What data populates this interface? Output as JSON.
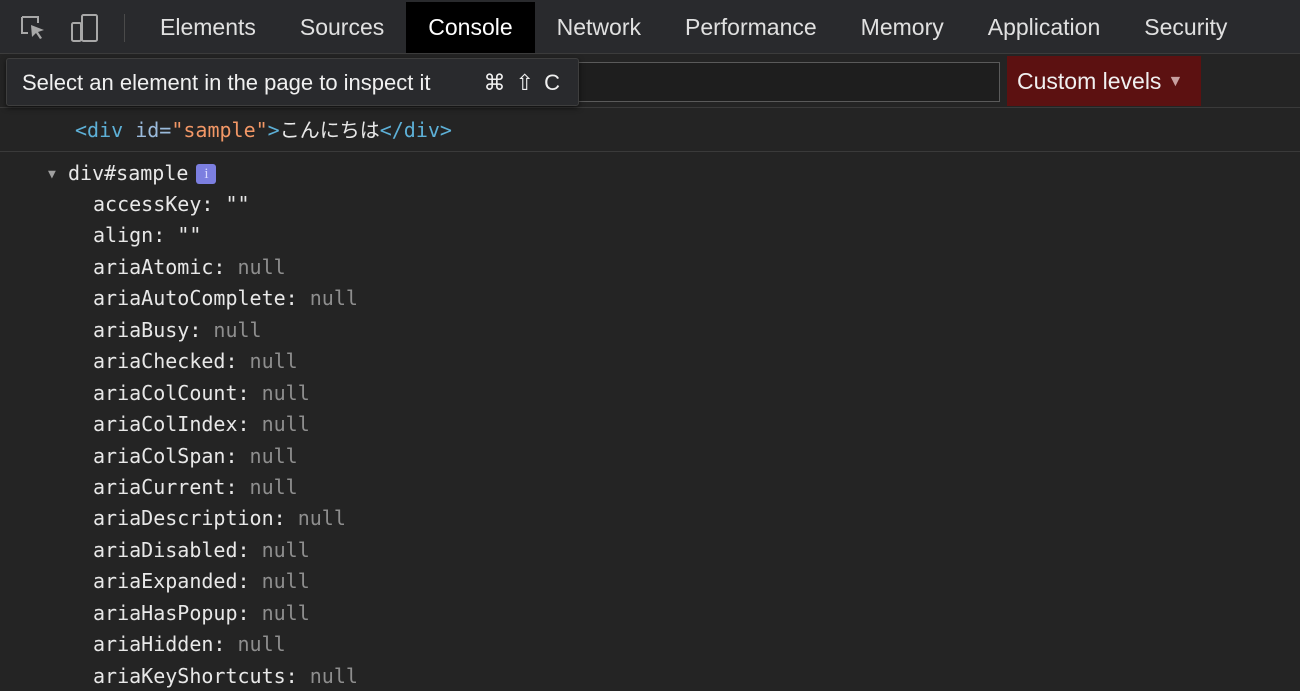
{
  "tabbar": {
    "tabs": [
      {
        "label": "Elements",
        "active": false
      },
      {
        "label": "Sources",
        "active": false
      },
      {
        "label": "Console",
        "active": true
      },
      {
        "label": "Network",
        "active": false
      },
      {
        "label": "Performance",
        "active": false
      },
      {
        "label": "Memory",
        "active": false
      },
      {
        "label": "Application",
        "active": false
      },
      {
        "label": "Security",
        "active": false
      }
    ],
    "icons": [
      "inspect-element-icon",
      "device-toolbar-icon"
    ]
  },
  "toolbar": {
    "filter_value": "",
    "levels_label": "Custom levels",
    "levels_arrow": "▼"
  },
  "tooltip": {
    "text": "Select an element in the page to inspect it",
    "shortcut": "⌘ ⇧ C"
  },
  "console": {
    "echo": {
      "open_tag": "<div",
      "attr_name": " id=",
      "attr_value": "\"sample\"",
      "open_end": ">",
      "text": "こんにちは",
      "close_tag": "</div>"
    },
    "object": {
      "label": "div#sample",
      "arrow": "▼",
      "badge": "i",
      "properties": [
        {
          "key": "accessKey",
          "value": "\"\"",
          "kind": "string"
        },
        {
          "key": "align",
          "value": "\"\"",
          "kind": "string"
        },
        {
          "key": "ariaAtomic",
          "value": "null",
          "kind": "null"
        },
        {
          "key": "ariaAutoComplete",
          "value": "null",
          "kind": "null"
        },
        {
          "key": "ariaBusy",
          "value": "null",
          "kind": "null"
        },
        {
          "key": "ariaChecked",
          "value": "null",
          "kind": "null"
        },
        {
          "key": "ariaColCount",
          "value": "null",
          "kind": "null"
        },
        {
          "key": "ariaColIndex",
          "value": "null",
          "kind": "null"
        },
        {
          "key": "ariaColSpan",
          "value": "null",
          "kind": "null"
        },
        {
          "key": "ariaCurrent",
          "value": "null",
          "kind": "null"
        },
        {
          "key": "ariaDescription",
          "value": "null",
          "kind": "null"
        },
        {
          "key": "ariaDisabled",
          "value": "null",
          "kind": "null"
        },
        {
          "key": "ariaExpanded",
          "value": "null",
          "kind": "null"
        },
        {
          "key": "ariaHasPopup",
          "value": "null",
          "kind": "null"
        },
        {
          "key": "ariaHidden",
          "value": "null",
          "kind": "null"
        },
        {
          "key": "ariaKeyShortcuts",
          "value": "null",
          "kind": "null"
        }
      ]
    }
  }
}
